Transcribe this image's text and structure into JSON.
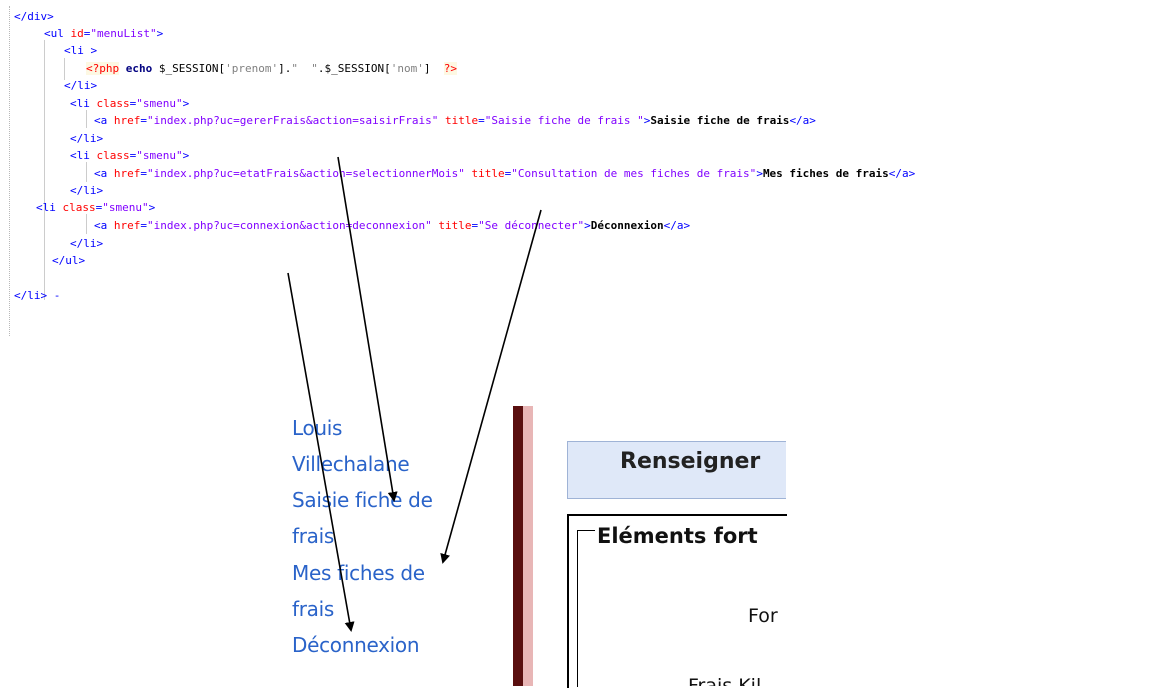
{
  "code_lines": [
    {
      "tokens": [
        {
          "cls": "tag",
          "t": "</div>"
        }
      ]
    },
    {
      "tokens": [
        {
          "cls": "tag",
          "t": "<ul "
        },
        {
          "cls": "attr",
          "t": "id"
        },
        {
          "cls": "tag",
          "t": "="
        },
        {
          "cls": "val",
          "t": "\"menuList\""
        },
        {
          "cls": "tag",
          "t": ">"
        }
      ]
    },
    {
      "tokens": [
        {
          "cls": "tag",
          "t": "<li >"
        }
      ]
    },
    {
      "tokens": [
        {
          "cls": "php-open",
          "t": "<?php"
        },
        {
          "cls": "php-op",
          "t": " "
        },
        {
          "cls": "php-kw",
          "t": "echo"
        },
        {
          "cls": "php-var",
          "t": " $_SESSION["
        },
        {
          "cls": "php-str",
          "t": "'prenom'"
        },
        {
          "cls": "php-var",
          "t": "]."
        },
        {
          "cls": "php-str",
          "t": "\"  \""
        },
        {
          "cls": "php-var",
          "t": ".$_SESSION["
        },
        {
          "cls": "php-str",
          "t": "'nom'"
        },
        {
          "cls": "php-var",
          "t": "]  "
        },
        {
          "cls": "php-open",
          "t": "?>"
        }
      ]
    },
    {
      "tokens": [
        {
          "cls": "tag",
          "t": "</li>"
        }
      ]
    },
    {
      "tokens": [
        {
          "cls": "tag",
          "t": "<li "
        },
        {
          "cls": "attr",
          "t": "class"
        },
        {
          "cls": "tag",
          "t": "="
        },
        {
          "cls": "val",
          "t": "\"smenu\""
        },
        {
          "cls": "tag",
          "t": ">"
        }
      ]
    },
    {
      "tokens": [
        {
          "cls": "tag",
          "t": "<a "
        },
        {
          "cls": "attr",
          "t": "href"
        },
        {
          "cls": "tag",
          "t": "="
        },
        {
          "cls": "val",
          "t": "\"index.php?uc=gererFrais&action=saisirFrais\""
        },
        {
          "cls": "tag",
          "t": " "
        },
        {
          "cls": "attr",
          "t": "title"
        },
        {
          "cls": "tag",
          "t": "="
        },
        {
          "cls": "val",
          "t": "\"Saisie fiche de frais \""
        },
        {
          "cls": "tag",
          "t": ">"
        },
        {
          "cls": "txt bold",
          "t": "Saisie fiche de frais"
        },
        {
          "cls": "tag",
          "t": "</a>"
        }
      ]
    },
    {
      "tokens": [
        {
          "cls": "tag",
          "t": "</li>"
        }
      ]
    },
    {
      "tokens": [
        {
          "cls": "tag",
          "t": "<li "
        },
        {
          "cls": "attr",
          "t": "class"
        },
        {
          "cls": "tag",
          "t": "="
        },
        {
          "cls": "val",
          "t": "\"smenu\""
        },
        {
          "cls": "tag",
          "t": ">"
        }
      ]
    },
    {
      "tokens": [
        {
          "cls": "tag",
          "t": "<a "
        },
        {
          "cls": "attr",
          "t": "href"
        },
        {
          "cls": "tag",
          "t": "="
        },
        {
          "cls": "val",
          "t": "\"index.php?uc=etatFrais&action=selectionnerMois\""
        },
        {
          "cls": "tag",
          "t": " "
        },
        {
          "cls": "attr",
          "t": "title"
        },
        {
          "cls": "tag",
          "t": "="
        },
        {
          "cls": "val",
          "t": "\"Consultation de mes fiches de frais\""
        },
        {
          "cls": "tag",
          "t": ">"
        },
        {
          "cls": "txt bold",
          "t": "Mes fiches de frais"
        },
        {
          "cls": "tag",
          "t": "</a>"
        }
      ]
    },
    {
      "tokens": [
        {
          "cls": "tag",
          "t": "</li>"
        }
      ]
    },
    {
      "tokens": [
        {
          "cls": "tag",
          "t": "<li "
        },
        {
          "cls": "attr",
          "t": "class"
        },
        {
          "cls": "tag",
          "t": "="
        },
        {
          "cls": "val",
          "t": "\"smenu\""
        },
        {
          "cls": "tag",
          "t": ">"
        }
      ]
    },
    {
      "tokens": [
        {
          "cls": "tag",
          "t": "<a "
        },
        {
          "cls": "attr",
          "t": "href"
        },
        {
          "cls": "tag",
          "t": "="
        },
        {
          "cls": "val",
          "t": "\"index.php?uc=connexion&action=deconnexion\""
        },
        {
          "cls": "tag",
          "t": " "
        },
        {
          "cls": "attr",
          "t": "title"
        },
        {
          "cls": "tag",
          "t": "="
        },
        {
          "cls": "val",
          "t": "\"Se déconnecter\""
        },
        {
          "cls": "tag",
          "t": ">"
        },
        {
          "cls": "txt bold",
          "t": "Déconnexion"
        },
        {
          "cls": "tag",
          "t": "</a>"
        }
      ]
    },
    {
      "tokens": [
        {
          "cls": "tag",
          "t": "</li>"
        }
      ]
    },
    {
      "tokens": [
        {
          "cls": "tag",
          "t": "</ul>"
        }
      ]
    },
    {
      "tokens": []
    },
    {
      "tokens": [
        {
          "cls": "tag",
          "t": "</li> -"
        }
      ]
    }
  ],
  "rendered": {
    "menu": {
      "user_first": "Louis",
      "user_last": "Villechalane",
      "item_saisie_1": "Saisie fiche de",
      "item_saisie_2": "frais",
      "item_fiches_1": "Mes fiches de",
      "item_fiches_2": "frais",
      "item_deconnexion": "Déconnexion"
    },
    "page_title": "Renseigner",
    "fieldset_legend": "Eléments fort",
    "label_forfait": "For",
    "label_frais_km": "Frais Kil"
  },
  "colors": {
    "link": "#2a63c9",
    "sidebar_dark": "#5a0f0f",
    "sidebar_light": "#e8b6b6",
    "title_bg": "#dfe8f8",
    "tag": "#0000ff",
    "attr": "#ff0000",
    "value": "#8000ff"
  }
}
